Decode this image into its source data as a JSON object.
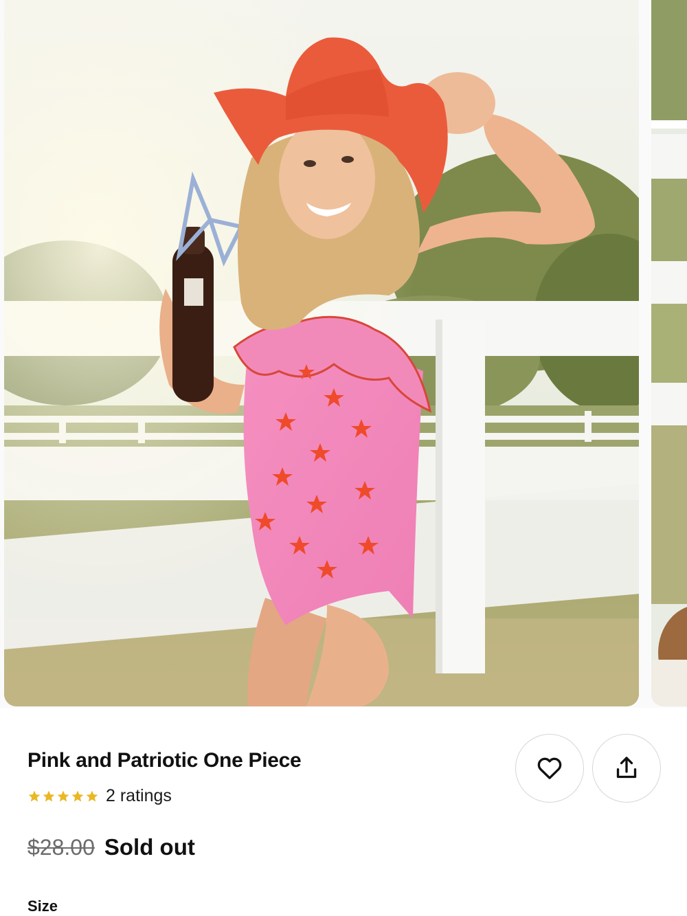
{
  "product": {
    "title": "Pink and Patriotic One Piece",
    "rating": {
      "stars": 5,
      "max_stars": 5,
      "ratings_text": "2 ratings",
      "star_color": "#E9B824"
    },
    "price": {
      "original": "$28.00",
      "status": "Sold out"
    },
    "size_label": "Size"
  },
  "gallery": {
    "current_image": "girl-in-pink-star-swimsuit-and-orange-cowboy-hat",
    "next_image": "partial-next-photo"
  },
  "actions": {
    "favorite_icon": "heart-icon",
    "share_icon": "share-icon"
  }
}
